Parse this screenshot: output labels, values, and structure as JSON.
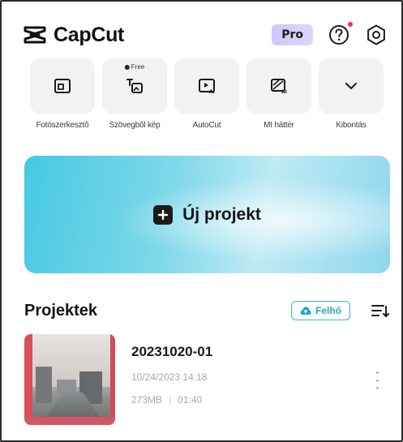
{
  "app": {
    "name": "CapCut",
    "pro_badge": "Pro"
  },
  "header": {
    "help_icon": "help-circle-icon",
    "settings_icon": "settings-icon",
    "notification_dot_color": "#ff2b55"
  },
  "tools": [
    {
      "label": "Fotószerkesztő",
      "icon": "photo-edit-icon"
    },
    {
      "label": "Szövegből kép",
      "icon": "text-to-image-icon",
      "badge": "Free"
    },
    {
      "label": "AutoCut",
      "icon": "autocut-icon"
    },
    {
      "label": "MI háttér",
      "icon": "ai-background-icon"
    },
    {
      "label": "Kibontás",
      "icon": "chevron-down-icon"
    }
  ],
  "new_project": {
    "label": "Új projekt",
    "icon": "plus-icon"
  },
  "projects_section": {
    "title": "Projektek",
    "cloud_button": "Felhő",
    "sort_icon": "sort-icon"
  },
  "projects": [
    {
      "name": "20231020-01",
      "date": "10/24/2023 14:18",
      "size": "273MB",
      "separator": "|",
      "duration": "01:40"
    }
  ],
  "colors": {
    "accent": "#22a7c4",
    "pro_badge_bg": "#d4ccff",
    "new_project_gradient_start": "#46c9e2"
  }
}
